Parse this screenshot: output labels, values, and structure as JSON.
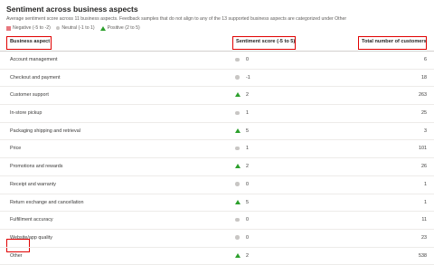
{
  "title": "Sentiment across business aspects",
  "subtitle": "Average sentiment score across 11 business aspects. Feedback samples that do not align to any of the 13 supported business aspects are categorized under Other",
  "legend": {
    "negative": "Negative (-5 to -2)",
    "neutral": "Neutral (-1 to 1)",
    "positive": "Positive (2 to 5)"
  },
  "columns": {
    "aspect": "Business aspect",
    "score": "Sentiment score (-5 to 5)",
    "total": "Total number of customers"
  },
  "colors": {
    "negative": "#e8787f",
    "neutral": "#c8c6c4",
    "positive": "#2ca02c",
    "highlight": "#e00000"
  },
  "rows": [
    {
      "aspect": "Account management",
      "icon": "neutral-dot-icon",
      "score": "0",
      "total": "6"
    },
    {
      "aspect": "Checkout and payment",
      "icon": "neutral-dot-icon",
      "score": "-1",
      "total": "18"
    },
    {
      "aspect": "Customer support",
      "icon": "positive-triangle-icon",
      "score": "2",
      "total": "263"
    },
    {
      "aspect": "In-store pickup",
      "icon": "neutral-dot-icon",
      "score": "1",
      "total": "25"
    },
    {
      "aspect": "Packaging shipping and retrieval",
      "icon": "positive-triangle-icon",
      "score": "5",
      "total": "3"
    },
    {
      "aspect": "Price",
      "icon": "neutral-dot-icon",
      "score": "1",
      "total": "101"
    },
    {
      "aspect": "Promotions and rewards",
      "icon": "positive-triangle-icon",
      "score": "2",
      "total": "26"
    },
    {
      "aspect": "Receipt and warranty",
      "icon": "neutral-dot-icon",
      "score": "0",
      "total": "1"
    },
    {
      "aspect": "Return exchange and cancellation",
      "icon": "positive-triangle-icon",
      "score": "5",
      "total": "1"
    },
    {
      "aspect": "Fulfillment accuracy",
      "icon": "neutral-dot-icon",
      "score": "0",
      "total": "11"
    },
    {
      "aspect": "Website/app quality",
      "icon": "neutral-dot-icon",
      "score": "0",
      "total": "23"
    },
    {
      "aspect": "Other",
      "icon": "positive-triangle-icon",
      "score": "2",
      "total": "538"
    }
  ]
}
